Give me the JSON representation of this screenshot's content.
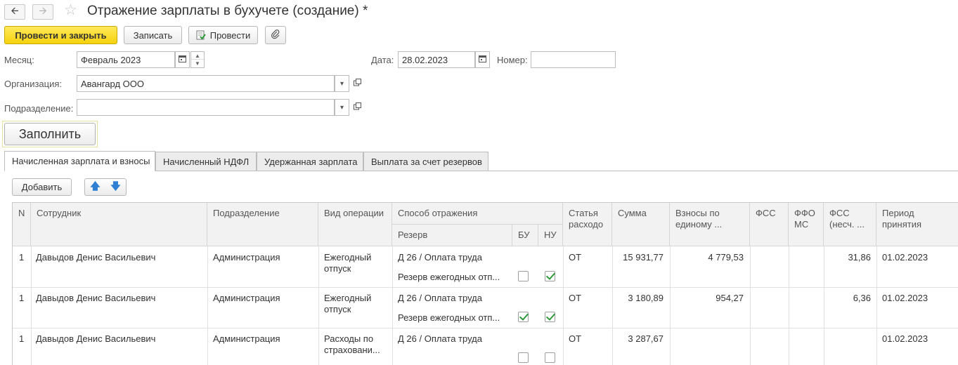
{
  "window": {
    "title": "Отражение зарплаты в бухучете (создание) *"
  },
  "toolbar": {
    "post_close": "Провести и закрыть",
    "save": "Записать",
    "post": "Провести"
  },
  "form": {
    "month_label": "Месяц:",
    "month_value": "Февраль 2023",
    "date_label": "Дата:",
    "date_value": "28.02.2023",
    "number_label": "Номер:",
    "number_value": "",
    "org_label": "Организация:",
    "org_value": "Авангард ООО",
    "dept_label": "Подразделение:",
    "dept_value": "",
    "fill_button": "Заполнить"
  },
  "tabs": [
    {
      "label": "Начисленная зарплата и взносы",
      "active": true
    },
    {
      "label": "Начисленный НДФЛ",
      "active": false
    },
    {
      "label": "Удержанная зарплата",
      "active": false
    },
    {
      "label": "Выплата за счет резервов",
      "active": false
    }
  ],
  "table_toolbar": {
    "add": "Добавить"
  },
  "columns": {
    "n": "N",
    "employee": "Сотрудник",
    "department": "Подразделение",
    "operation": "Вид операции",
    "method": "Способ отражения",
    "reserve": "Резерв",
    "bu": "БУ",
    "nu": "НУ",
    "expense_item_1": "Статья",
    "expense_item_2": "расходо",
    "sum": "Сумма",
    "contrib_1": "Взносы по",
    "contrib_2": "единому ...",
    "fss": "ФСС",
    "ffoms_1": "ФФО",
    "ffoms_2": "МС",
    "fss_ns_1": "ФСС",
    "fss_ns_2": "(несч. ...",
    "period": "Период принятия"
  },
  "rows": [
    {
      "n": "1",
      "employee": "Давыдов Денис Васильевич",
      "department": "Администрация",
      "operation_1": "Ежегодный",
      "operation_2": "отпуск",
      "method": "Д 26 / Оплата труда",
      "reserve": "Резерв ежегодных отп...",
      "bu": false,
      "nu": true,
      "expense_item": "ОТ",
      "sum": "15 931,77",
      "contrib": "4 779,53",
      "fss": "",
      "ffoms": "",
      "fss_ns": "31,86",
      "period": "01.02.2023"
    },
    {
      "n": "1",
      "employee": "Давыдов Денис Васильевич",
      "department": "Администрация",
      "operation_1": "Ежегодный",
      "operation_2": "отпуск",
      "method": "Д 26 / Оплата труда",
      "reserve": "Резерв ежегодных отп...",
      "bu": true,
      "nu": true,
      "expense_item": "ОТ",
      "sum": "3 180,89",
      "contrib": "954,27",
      "fss": "",
      "ffoms": "",
      "fss_ns": "6,36",
      "period": "01.02.2023"
    },
    {
      "n": "1",
      "employee": "Давыдов Денис Васильевич",
      "department": "Администрация",
      "operation_1": "Расходы по",
      "operation_2": "страховани...",
      "method": "Д 26 / Оплата труда",
      "reserve": "",
      "bu": false,
      "nu": false,
      "expense_item": "ОТ",
      "sum": "3 287,67",
      "contrib": "",
      "fss": "",
      "ffoms": "",
      "fss_ns": "",
      "period": "01.02.2023"
    }
  ]
}
